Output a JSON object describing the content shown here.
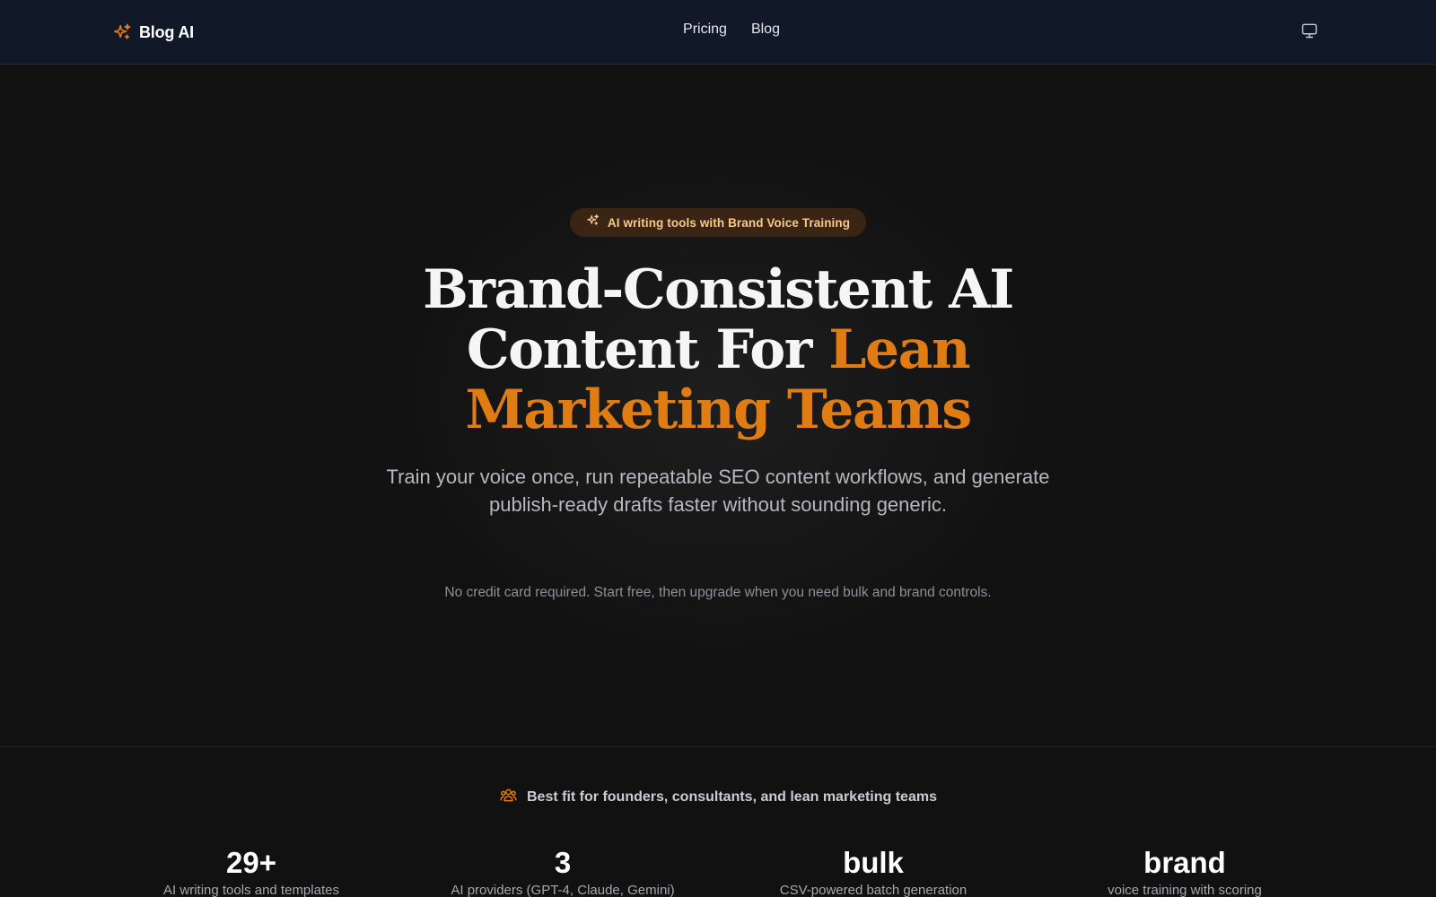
{
  "nav": {
    "brand_name": "Blog AI",
    "links": [
      {
        "label": "Pricing"
      },
      {
        "label": "Blog"
      }
    ],
    "theme_toggle_icon": "monitor-icon"
  },
  "hero": {
    "badge": {
      "icon": "sparkles-icon",
      "text": "AI writing tools with Brand Voice Training"
    },
    "headline": {
      "line1": "Brand-Consistent AI",
      "line2_plain": "Content For ",
      "line2_accent": "Lean",
      "line3_accent": "Marketing Teams"
    },
    "subheadline": "Train your voice once, run repeatable SEO content workflows, and generate publish-ready drafts faster without sounding generic.",
    "fineprint": "No credit card required. Start free, then upgrade when you need bulk and brand controls."
  },
  "audience": {
    "icon": "users-icon",
    "text": "Best fit for founders, consultants, and lean marketing teams"
  },
  "stats": [
    {
      "value": "29+",
      "label": "AI writing tools and templates"
    },
    {
      "value": "3",
      "label": "AI providers (GPT-4, Claude, Gemini)"
    },
    {
      "value": "bulk",
      "label": "CSV-powered batch generation"
    },
    {
      "value": "brand",
      "label": "voice training with scoring"
    }
  ],
  "colors": {
    "nav_bg": "#111827",
    "page_bg": "#111111",
    "accent": "#e07c14",
    "badge_bg": "#3a2414",
    "badge_text": "#f6c98c"
  }
}
